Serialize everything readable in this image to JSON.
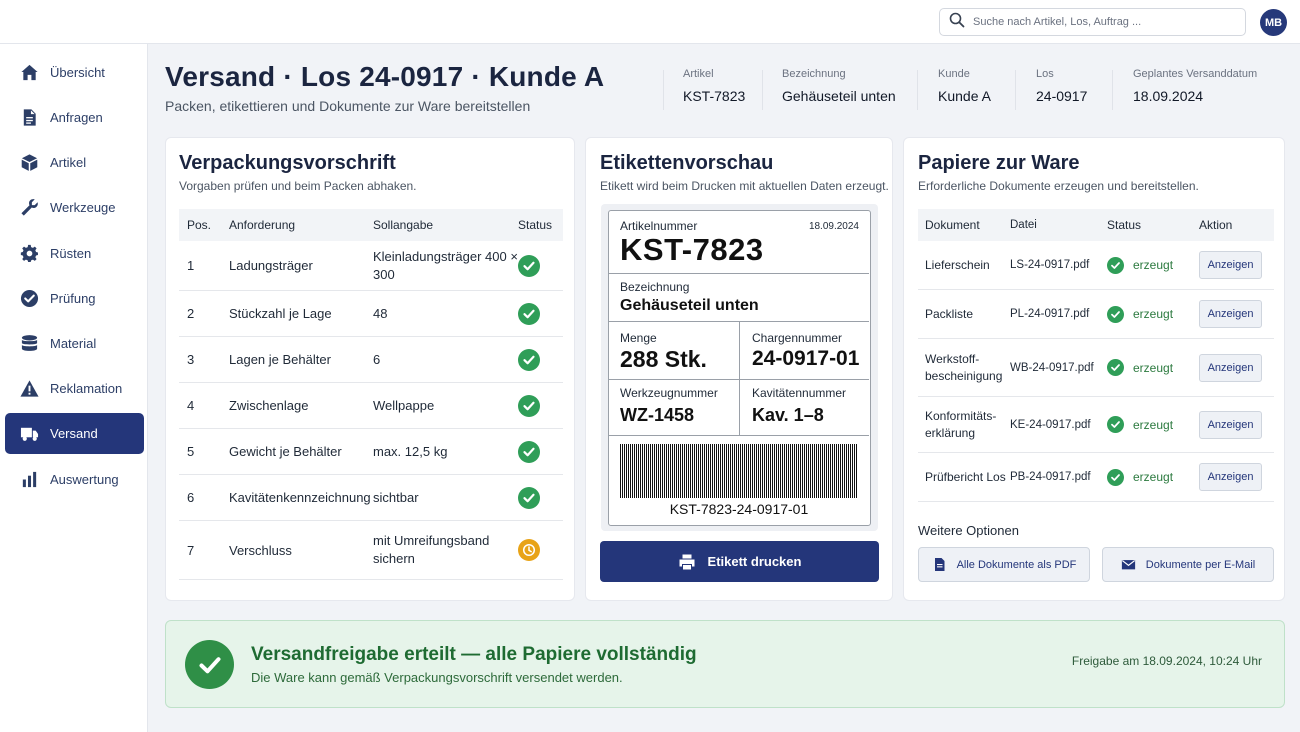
{
  "search": {
    "placeholder": "Suche nach Artikel, Los, Auftrag ..."
  },
  "user": {
    "initials": "MB"
  },
  "sidebar": {
    "items": [
      {
        "label": "Übersicht",
        "icon": "home-icon"
      },
      {
        "label": "Anfragen",
        "icon": "document-icon"
      },
      {
        "label": "Artikel",
        "icon": "cube-icon"
      },
      {
        "label": "Werkzeuge",
        "icon": "wrench-icon"
      },
      {
        "label": "Rüsten",
        "icon": "gear-icon"
      },
      {
        "label": "Prüfung",
        "icon": "check-circle-icon"
      },
      {
        "label": "Material",
        "icon": "database-icon"
      },
      {
        "label": "Reklamation",
        "icon": "warning-icon"
      },
      {
        "label": "Versand",
        "icon": "truck-icon",
        "active": true
      },
      {
        "label": "Auswertung",
        "icon": "bar-chart-icon"
      }
    ]
  },
  "header": {
    "title": "Versand · Los 24-0917 · Kunde A",
    "subtitle": "Packen, etikettieren und Dokumente zur Ware bereitstellen",
    "meta": [
      {
        "label": "Artikel",
        "value": "KST-7823"
      },
      {
        "label": "Bezeichnung",
        "value": "Gehäuseteil unten"
      },
      {
        "label": "Kunde",
        "value": "Kunde A"
      },
      {
        "label": "Los",
        "value": "24-0917"
      },
      {
        "label": "Geplantes Versanddatum",
        "value": "18.09.2024"
      }
    ]
  },
  "packing": {
    "title": "Verpackungsvorschrift",
    "subtitle": "Vorgaben prüfen und beim Packen abhaken.",
    "columns": {
      "pos": "Pos.",
      "req": "Anforderung",
      "target": "Sollangabe",
      "status": "Status"
    },
    "rows": [
      {
        "pos": "1",
        "req": "Ladungsträger",
        "target": "Kleinladungsträger 400 × 300",
        "status": "ok"
      },
      {
        "pos": "2",
        "req": "Stückzahl je Lage",
        "target": "48",
        "status": "ok"
      },
      {
        "pos": "3",
        "req": "Lagen je Behälter",
        "target": "6",
        "status": "ok"
      },
      {
        "pos": "4",
        "req": "Zwischenlage",
        "target": "Wellpappe",
        "status": "ok"
      },
      {
        "pos": "5",
        "req": "Gewicht je Behälter",
        "target": "max. 12,5 kg",
        "status": "ok"
      },
      {
        "pos": "6",
        "req": "Kavitätenkennzeichnung",
        "target": "sichtbar",
        "status": "ok"
      },
      {
        "pos": "7",
        "req": "Verschluss",
        "target": "mit Umreifungsband sichern",
        "status": "pending"
      }
    ]
  },
  "label_preview": {
    "title": "Etikettenvorschau",
    "subtitle": "Etikett wird beim Drucken mit aktuellen Daten erzeugt.",
    "article_label": "Artikelnummer",
    "article_value": "KST-7823",
    "date": "18.09.2024",
    "desc_label": "Bezeichnung",
    "desc_value": "Gehäuseteil unten",
    "qty_label": "Menge",
    "qty_value": "288 Stk.",
    "batch_label": "Chargennummer",
    "batch_value": "24-0917-01",
    "tool_label": "Werkzeugnummer",
    "tool_value": "WZ-1458",
    "cav_label": "Kavitätennummer",
    "cav_value": "Kav. 1–8",
    "barcode_text": "KST-7823-24-0917-01",
    "print_button": "Etikett drucken"
  },
  "documents": {
    "title": "Papiere zur Ware",
    "subtitle": "Erforderliche Dokumente erzeugen und bereitstellen.",
    "columns": {
      "doc": "Dokument",
      "file": "Datei",
      "status": "Status",
      "action": "Aktion"
    },
    "rows": [
      {
        "doc": "Lieferschein",
        "file": "LS-24-0917.pdf",
        "status": "erzeugt",
        "action": "Anzeigen"
      },
      {
        "doc": "Packliste",
        "file": "PL-24-0917.pdf",
        "status": "erzeugt",
        "action": "Anzeigen"
      },
      {
        "doc": "Werkstoff-bescheinigung",
        "file": "WB-24-0917.pdf",
        "status": "erzeugt",
        "action": "Anzeigen"
      },
      {
        "doc": "Konformitäts-erklärung",
        "file": "KE-24-0917.pdf",
        "status": "erzeugt",
        "action": "Anzeigen"
      },
      {
        "doc": "Prüfbericht Los",
        "file": "PB-24-0917.pdf",
        "status": "erzeugt",
        "action": "Anzeigen"
      }
    ],
    "more_options": "Weitere Optionen",
    "all_pdf_button": "Alle Dokumente als PDF",
    "email_button": "Dokumente per E-Mail"
  },
  "release": {
    "title": "Versandfreigabe erteilt — alle Papiere vollständig",
    "subtitle": "Die Ware kann gemäß Verpackungsvorschrift versendet werden.",
    "timestamp": "Freigabe am 18.09.2024, 10:24 Uhr"
  },
  "colors": {
    "primary": "#24367a",
    "success": "#2f9e58",
    "pending": "#e8a317",
    "release_bg": "#e6f4ea"
  }
}
